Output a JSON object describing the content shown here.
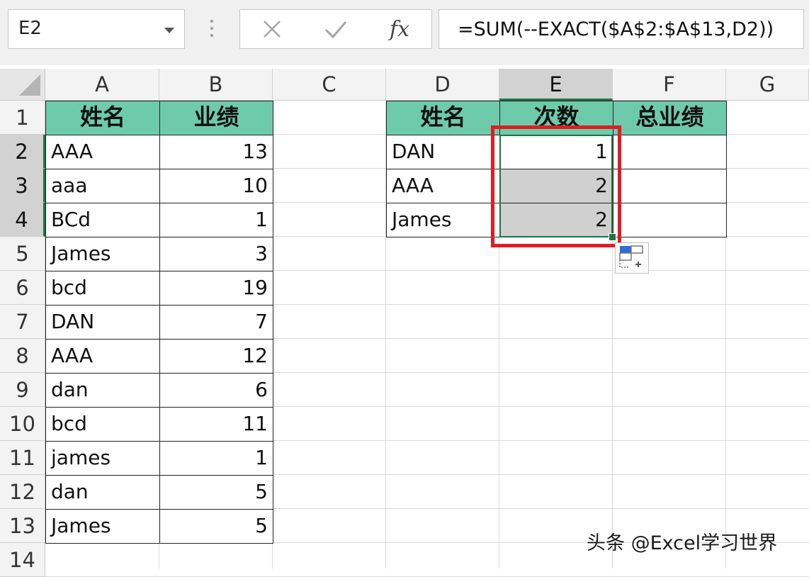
{
  "name_box": {
    "value": "E2"
  },
  "formula_bar": {
    "fx_label": "fx",
    "formula": "=SUM(--EXACT($A$2:$A$13,D2))"
  },
  "columns": [
    "A",
    "B",
    "C",
    "D",
    "E",
    "F",
    "G"
  ],
  "selected_column": "E",
  "rows": [
    "1",
    "2",
    "3",
    "4",
    "5",
    "6",
    "7",
    "8",
    "9",
    "10",
    "11",
    "12",
    "13",
    "14"
  ],
  "selected_rows": [
    "2",
    "3",
    "4"
  ],
  "table_left": {
    "headers": [
      "姓名",
      "业绩"
    ],
    "rows": [
      [
        "AAA",
        "13"
      ],
      [
        "aaa",
        "10"
      ],
      [
        "BCd",
        "1"
      ],
      [
        "James",
        "3"
      ],
      [
        "bcd",
        "19"
      ],
      [
        "DAN",
        "7"
      ],
      [
        "AAA",
        "12"
      ],
      [
        "dan",
        "6"
      ],
      [
        "bcd",
        "11"
      ],
      [
        "james",
        "1"
      ],
      [
        "dan",
        "5"
      ],
      [
        "James",
        "5"
      ]
    ]
  },
  "table_right": {
    "headers": [
      "姓名",
      "次数",
      "总业绩"
    ],
    "rows": [
      [
        "DAN",
        "1",
        ""
      ],
      [
        "AAA",
        "2",
        ""
      ],
      [
        "James",
        "2",
        ""
      ]
    ]
  },
  "colors": {
    "header_fill": "#6dcbab",
    "selection": "#217346",
    "highlight_box": "#e01c24"
  },
  "watermark": "头条 @Excel学习世界"
}
